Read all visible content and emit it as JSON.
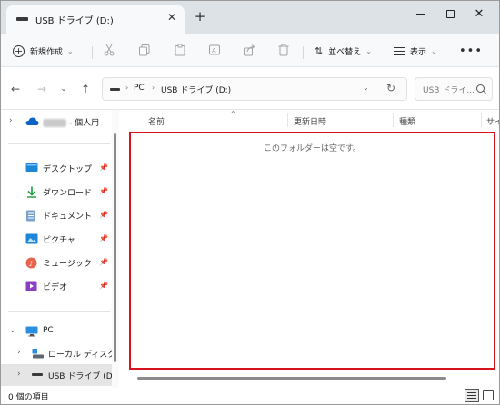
{
  "window": {
    "tab_title": "USB ドライブ (D:)",
    "close_glyph": "✕",
    "new_tab_glyph": "+",
    "window_close_glyph": "✕"
  },
  "toolbar": {
    "new_label": "新規作成",
    "sort_label": "並べ替え",
    "view_label": "表示",
    "more_glyph": "•••",
    "disabled_icons": [
      "cut-icon",
      "copy-icon",
      "paste-icon",
      "rename-icon",
      "share-icon",
      "delete-icon"
    ]
  },
  "address": {
    "crumbs": [
      "PC",
      "USB ドライブ (D:)"
    ],
    "search_placeholder": "USB ドライ..."
  },
  "nav_pane": {
    "onedrive_suffix": "- 個人用",
    "quick_access": [
      {
        "label": "デスクトップ",
        "icon": "desktop-icon"
      },
      {
        "label": "ダウンロード",
        "icon": "download-icon"
      },
      {
        "label": "ドキュメント",
        "icon": "documents-icon"
      },
      {
        "label": "ピクチャ",
        "icon": "pictures-icon"
      },
      {
        "label": "ミュージック",
        "icon": "music-icon"
      },
      {
        "label": "ビデオ",
        "icon": "videos-icon"
      }
    ],
    "pc_label": "PC",
    "local_disk_label": "ローカル ディスク (C",
    "usb_label": "USB ドライブ (D:)"
  },
  "columns": [
    "名前",
    "更新日時",
    "種類",
    "サイ"
  ],
  "empty_message": "このフォルダーは空です。",
  "status": {
    "item_count": "0 個の項目"
  },
  "colors": {
    "highlight": "#d6121b",
    "accent": "#0067c0",
    "selected": "#e5e5e5"
  }
}
